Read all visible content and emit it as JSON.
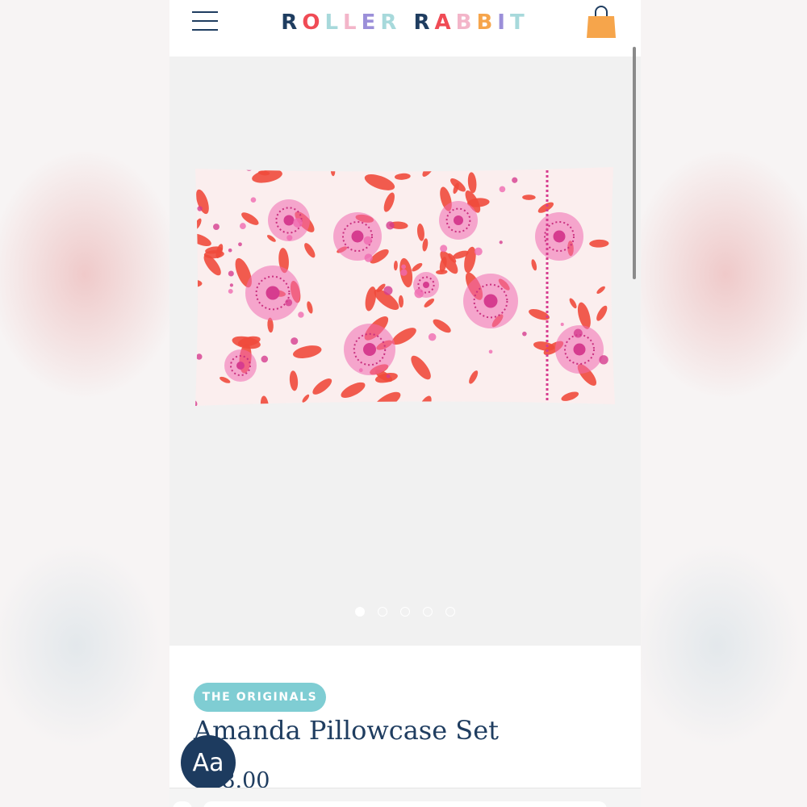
{
  "header": {
    "menu_icon": "hamburger-menu-icon",
    "bag_icon": "shopping-bag-icon",
    "logo": {
      "letters": [
        {
          "char": "R",
          "color": "#1f3d60"
        },
        {
          "char": "O",
          "color": "#f04b55"
        },
        {
          "char": "L",
          "color": "#a7d9db"
        },
        {
          "char": "L",
          "color": "#f3b5c9"
        },
        {
          "char": "E",
          "color": "#9b8fd9"
        },
        {
          "char": "R",
          "color": "#a7d9db"
        },
        {
          "char": " ",
          "color": "#ffffff"
        },
        {
          "char": "R",
          "color": "#1f3d60"
        },
        {
          "char": "A",
          "color": "#f04b55"
        },
        {
          "char": "B",
          "color": "#f3b5c9"
        },
        {
          "char": "B",
          "color": "#f6a54b"
        },
        {
          "char": "I",
          "color": "#9b8fd9"
        },
        {
          "char": "T",
          "color": "#a7d9db"
        }
      ]
    }
  },
  "gallery": {
    "image_alt": "Amanda Pillowcase Set floral pillowcase",
    "dots": [
      true,
      false,
      false,
      false,
      false
    ]
  },
  "product": {
    "badge": "THE ORIGINALS",
    "title": "Amanda Pillowcase Set",
    "price": "$78.00"
  },
  "accessibility_button": "Aa",
  "colors": {
    "navy": "#1f3d60",
    "badge": "#7fcdd3",
    "coral": "#ef4a3c",
    "pink": "#f06ab0",
    "bag": "#f6a54b"
  }
}
